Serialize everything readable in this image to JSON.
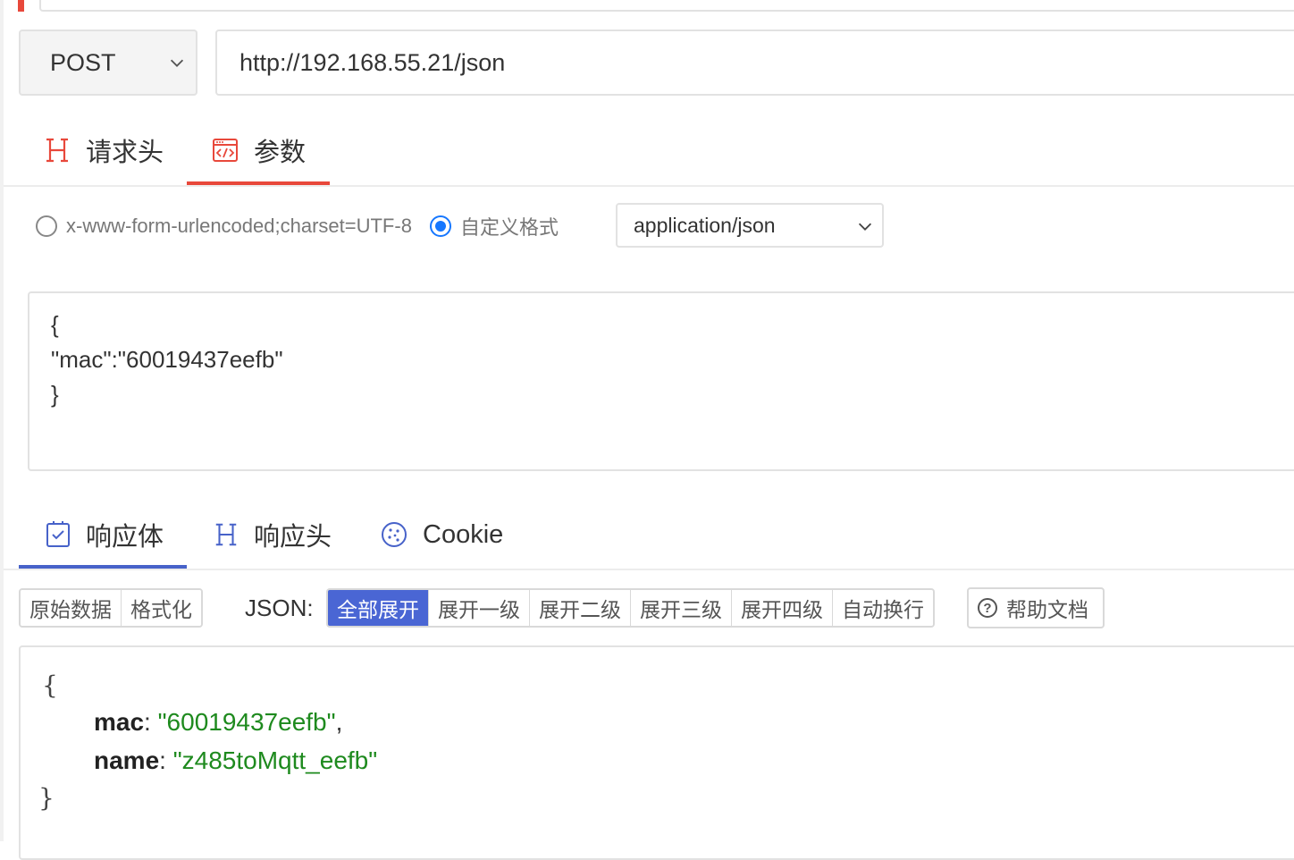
{
  "request": {
    "method": "POST",
    "url": "http://192.168.55.21/json",
    "tabs": [
      {
        "label": "请求头",
        "icon": "header-h-icon"
      },
      {
        "label": "参数",
        "icon": "code-window-icon",
        "active": true
      }
    ],
    "body_formats": [
      {
        "label": "x-www-form-urlencoded;charset=UTF-8",
        "checked": false
      },
      {
        "label": "自定义格式",
        "checked": true
      }
    ],
    "content_type": "application/json",
    "body_lines": [
      "{",
      "\"mac\":\"60019437eefb\"",
      "}"
    ]
  },
  "response": {
    "tabs": [
      {
        "label": "响应体",
        "icon": "checkbox-clipboard-icon",
        "active": true
      },
      {
        "label": "响应头",
        "icon": "header-h-icon"
      },
      {
        "label": "Cookie",
        "icon": "cookie-icon"
      }
    ],
    "view_buttons": [
      "原始数据",
      "格式化"
    ],
    "json_label": "JSON:",
    "json_buttons": [
      "全部展开",
      "展开一级",
      "展开二级",
      "展开三级",
      "展开四级",
      "自动换行"
    ],
    "json_active": "全部展开",
    "help_label": "帮助文档",
    "json": {
      "open": "{",
      "close": "}",
      "entries": [
        {
          "key": "mac",
          "value": "\"60019437eefb\"",
          "suffix": ","
        },
        {
          "key": "name",
          "value": "\"z485toMqtt_eefb\"",
          "suffix": ""
        }
      ]
    }
  },
  "colors": {
    "request_accent": "#e8483b",
    "response_accent": "#4762c9",
    "json_value": "#1e8a1e",
    "radio_checked": "#1677ff"
  }
}
